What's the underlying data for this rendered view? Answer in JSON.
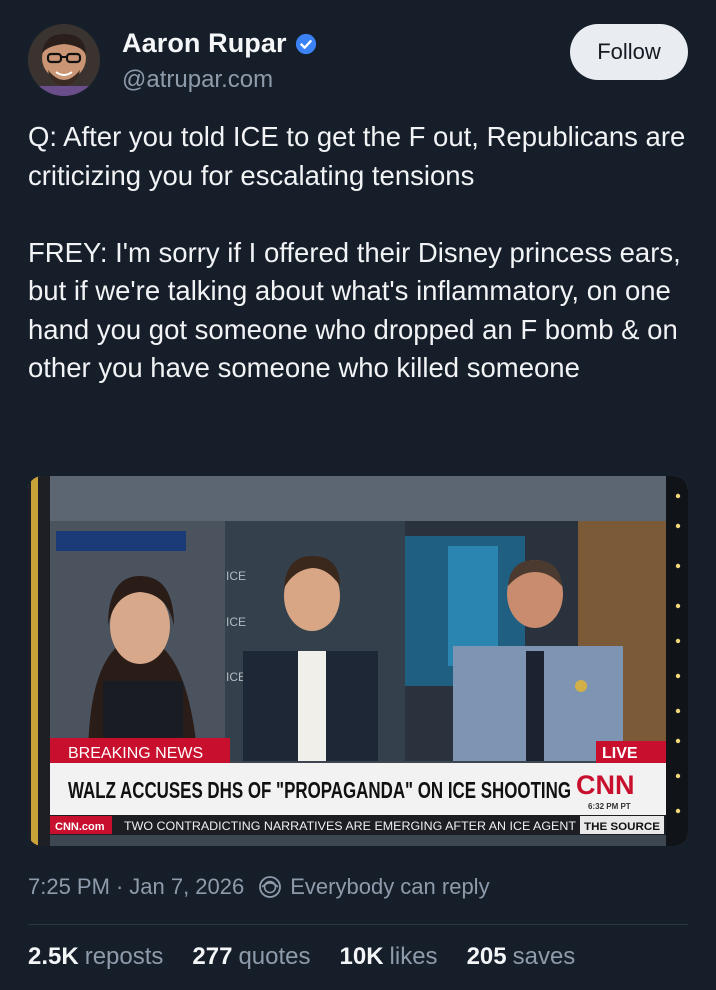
{
  "author": {
    "display_name": "Aaron Rupar",
    "handle": "@atrupar.com",
    "verified": true,
    "verified_color": "#3b82f6"
  },
  "follow_label": "Follow",
  "post_text": "Q: After you told ICE to get the F out, Republicans are criticizing you for escalating tensions\n\nFREY: I'm sorry if I offered their Disney princess ears, but if we're talking about what's inflammatory, on one hand you got someone who dropped an F bomb & on other you have someone who killed someone",
  "media": {
    "breaking_label": "BREAKING NEWS",
    "live_label": "LIVE",
    "headline": "WALZ ACCUSES DHS OF \"PROPAGANDA\" ON ICE SHOOTING",
    "network_logo": "CNN",
    "time": "6:32 PM PT",
    "site": "CNN.com",
    "ticker": "TWO CONTRADICTING NARRATIVES ARE EMERGING AFTER AN ICE AGENT",
    "show_name": "THE SOURCE",
    "backdrop_text": "ICE",
    "accent_red": "#c8102e"
  },
  "meta": {
    "time": "7:25 PM",
    "separator": "·",
    "date": "Jan 7, 2026",
    "reply_setting": "Everybody can reply"
  },
  "stats": [
    {
      "num": "2.5K",
      "label": "reposts"
    },
    {
      "num": "277",
      "label": "quotes"
    },
    {
      "num": "10K",
      "label": "likes"
    },
    {
      "num": "205",
      "label": "saves"
    }
  ]
}
